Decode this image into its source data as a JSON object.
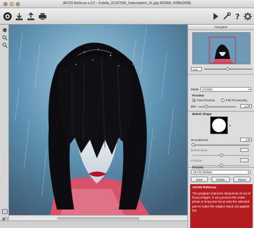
{
  "window": {
    "title": "AKVIS Refocus v.3.5 – Fotolia_31337546_Subscription_XL.jpg (RGB/8, 4288x2848)"
  },
  "toolbar": {
    "left_icons": [
      "app-logo-icon",
      "open-icon",
      "save-icon",
      "print-icon"
    ],
    "right_icons": [
      "run-icon",
      "settings-icon",
      "help-icon",
      "preferences-icon"
    ]
  },
  "left_tools": [
    "hand-icon",
    "zoom-icon",
    "navigator-icon"
  ],
  "navigator": {
    "title": "Navigator",
    "zoom_value": "19%"
  },
  "settings": {
    "mode_label": "Mode",
    "mode_value": "Iris Blur",
    "preview_heading": "Preview",
    "fast_preview": "Fast Preview",
    "full_processing": "Full Processing",
    "blur_label": "Blur",
    "blur_value": "15",
    "bokeh_heading": "Bokeh Shape",
    "smoothness_label": "Smoothness",
    "smoothness_value": "0",
    "deformation_label": "Deformation",
    "rotation_label": "Rotation"
  },
  "presets": {
    "heading": "Presets",
    "selected": "AKVIS Default",
    "save_label": "Save",
    "delete_label": "Delete",
    "reset_label": "Reset"
  },
  "info": {
    "heading": "AKVIS Refocus",
    "body": "The program improves sharpness of out of focus images. It can process the entire photo or bring into focus only the selected part to make the subject stand out against the"
  },
  "colors": {
    "accent": "#b51c22",
    "canvas_bg": "#5b8fb0"
  }
}
